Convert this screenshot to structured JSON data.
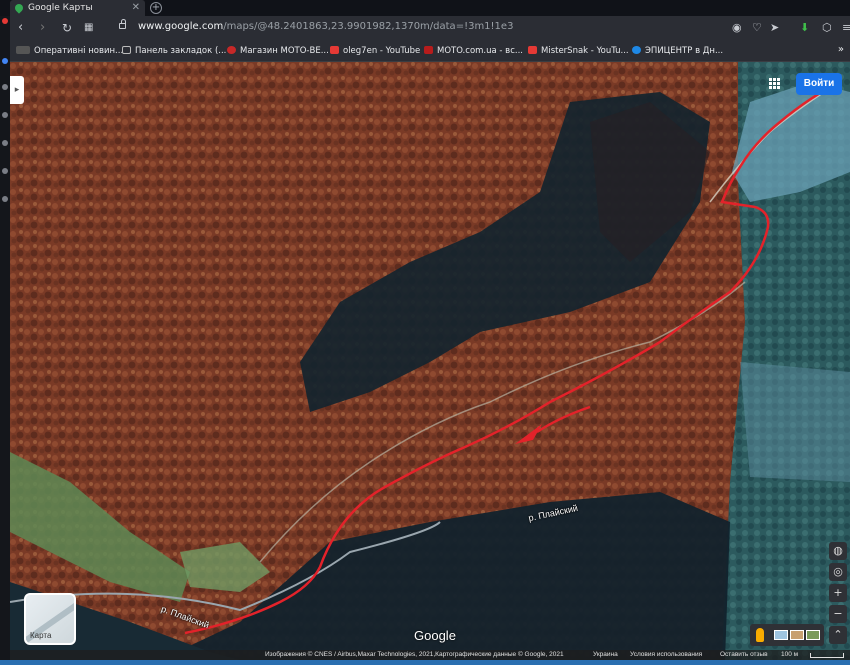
{
  "browser": {
    "tab_title": "Google Карты",
    "tab_close": "✕",
    "new_tab": "+",
    "url_domain": "www.google.com",
    "url_rest": "/maps/@48.2401863,23.9901982,1370m/data=!3m1!1e3"
  },
  "bookmarks": {
    "items": [
      "Оперативні новин...",
      "Панель закладок (...",
      "Магазин МОТО-ВЕ...",
      "oleg7en - YouTube",
      "MOTO.com.ua - вс...",
      "MisterSnak - YouTu...",
      "ЭПИЦЕНТР в Дн..."
    ],
    "more": "»"
  },
  "map": {
    "sign_in": "Войти",
    "river_label_1": "р. Плайский",
    "river_label_2": "р. Плайский",
    "layer_label": "Карта",
    "logo": "Google",
    "zoom_in": "+",
    "zoom_out": "−"
  },
  "footer": {
    "imagery": "Изображения © CNES / Airbus,Maxar Technologies, 2021,Картографические данные © Google, 2021",
    "country": "Украина",
    "terms": "Условия использования",
    "feedback": "Оставить отзыв",
    "scale": "100 м"
  }
}
